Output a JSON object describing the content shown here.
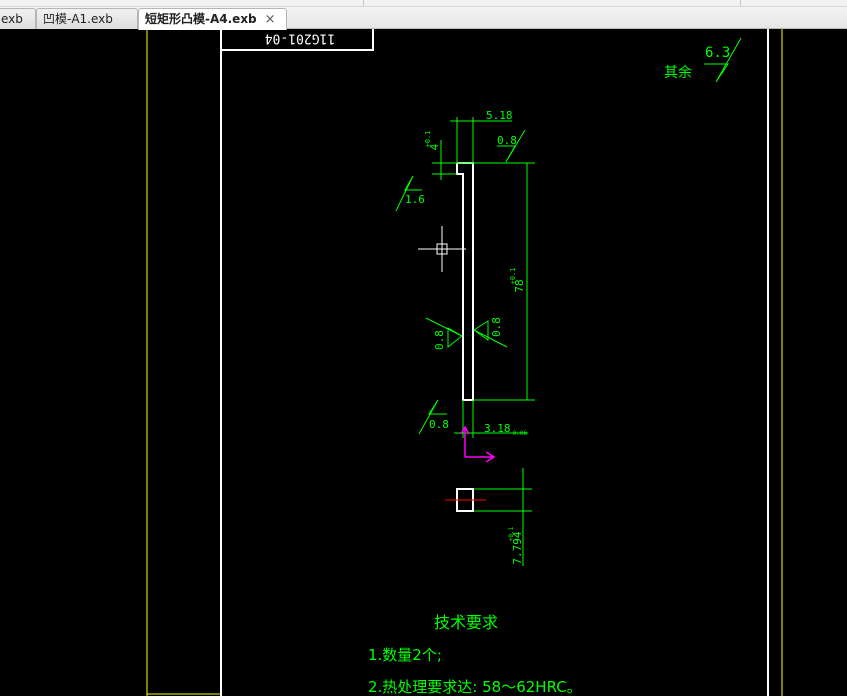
{
  "tabs": [
    {
      "label": "exb",
      "active": false
    },
    {
      "label": "凹模-A1.exb",
      "active": false
    },
    {
      "label": "短矩形凸模-A4.exb",
      "active": true,
      "close": "×"
    }
  ],
  "drawing": {
    "title_block_text": "11G201-04",
    "roughness_other_label": "其余",
    "roughness_other_value": "6.3",
    "dim_top_width": "5.18",
    "dim_top_height": "4",
    "dim_top_height_tol": "+0.1",
    "roughness_top": "0.8",
    "roughness_left_top": "1.6",
    "dim_length": "78",
    "dim_length_tol": "+0.1",
    "roughness_left_mid": "0.8",
    "roughness_right_mid": "0.8",
    "roughness_bottom": "0.8",
    "dim_bottom_width": "3.18",
    "dim_bottom_width_tol": "-0.06",
    "dim_section_height": "7.794",
    "dim_section_tol": "+0.1",
    "tech_title": "技术要求",
    "tech_items": [
      "1.数量2个;",
      "2.热处理要求达: 58～62HRC。"
    ]
  },
  "colors": {
    "green": "#00ff00",
    "yellow": "#ffff00",
    "white": "#ffffff",
    "magenta": "#ff00ff",
    "red": "#ff0000"
  }
}
